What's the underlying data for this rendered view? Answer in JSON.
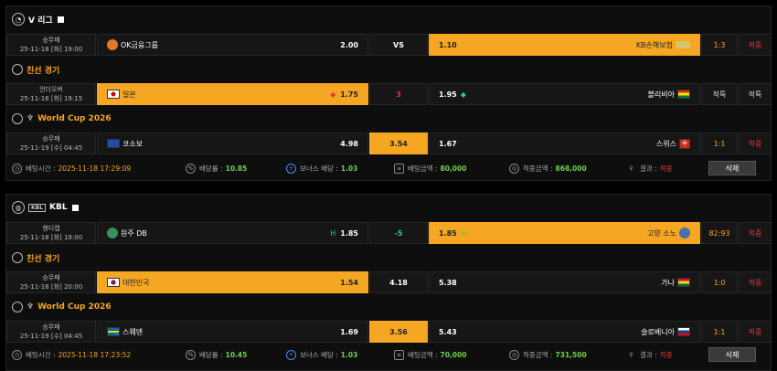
{
  "slips": [
    {
      "league": {
        "name": "V 리그",
        "color": "yellow"
      },
      "matches": [
        {
          "type": "승무패",
          "date": "25-11-18 [화] 19:00",
          "home": "OK금융그룹",
          "home_odds": "2.00",
          "draw": "VS",
          "away_odds": "1.10",
          "away": "KB손해보험",
          "score": "1:3",
          "result": "적중",
          "pick": "away"
        },
        {
          "section": "친선 경기",
          "type": "언더오버",
          "date": "25-11-18 [화] 19:15",
          "home": "일본",
          "home_odds": "1.75",
          "draw": "3",
          "away_odds": "1.95",
          "away": "볼리비아",
          "score": "적특",
          "result": "적특",
          "pick": "home"
        },
        {
          "section": "World Cup 2026",
          "type": "승무패",
          "date": "25-11-19 [수] 04:45",
          "home": "코소보",
          "home_odds": "4.98",
          "draw": "3.54",
          "away_odds": "1.67",
          "away": "스위스",
          "score": "1:1",
          "result": "적중",
          "pick": "draw"
        }
      ],
      "summary": {
        "bet_time_label": "배팅시간 :",
        "bet_time": "2025-11-18 17:29:09",
        "odds_label": "배당률 :",
        "odds": "10.85",
        "bonus_label": "보너스 배당 :",
        "bonus": "1.03",
        "amount_label": "배팅금액 :",
        "amount": "80,000",
        "win_label": "적중금액 :",
        "win": "868,000",
        "result_label": "결과 :",
        "result": "적중",
        "delete": "삭제"
      }
    },
    {
      "league": {
        "name": "KBL",
        "color": "yellow"
      },
      "matches": [
        {
          "type": "핸디캡",
          "date": "25-11-18 [화] 19:00",
          "home": "원주 DB",
          "home_odds": "1.85",
          "home_tag": "H",
          "draw": "-5",
          "away_tag": "H",
          "away_odds": "1.85",
          "away": "고양 소노",
          "score": "82:93",
          "result": "적중",
          "pick": "away"
        },
        {
          "section": "친선 경기",
          "type": "승무패",
          "date": "25-11-18 [화] 20:00",
          "home": "대한민국",
          "home_odds": "1.54",
          "draw": "4.18",
          "away_odds": "5.38",
          "away": "가나",
          "score": "1:0",
          "result": "적중",
          "pick": "home"
        },
        {
          "section": "World Cup 2026",
          "type": "승무패",
          "date": "25-11-19 [수] 04:45",
          "home": "스웨덴",
          "home_odds": "1.69",
          "draw": "3.56",
          "away_odds": "5.43",
          "away": "슬로베니아",
          "score": "1:1",
          "result": "적중",
          "pick": "draw"
        }
      ],
      "summary": {
        "bet_time_label": "배팅시간 :",
        "bet_time": "2025-11-18 17:23:52",
        "odds_label": "배당률 :",
        "odds": "10.45",
        "bonus_label": "보너스 배당 :",
        "bonus": "1.03",
        "amount_label": "배팅금액 :",
        "amount": "70,000",
        "win_label": "적중금액 :",
        "win": "731,500",
        "result_label": "결과 :",
        "result": "적중",
        "delete": "삭제"
      }
    }
  ]
}
